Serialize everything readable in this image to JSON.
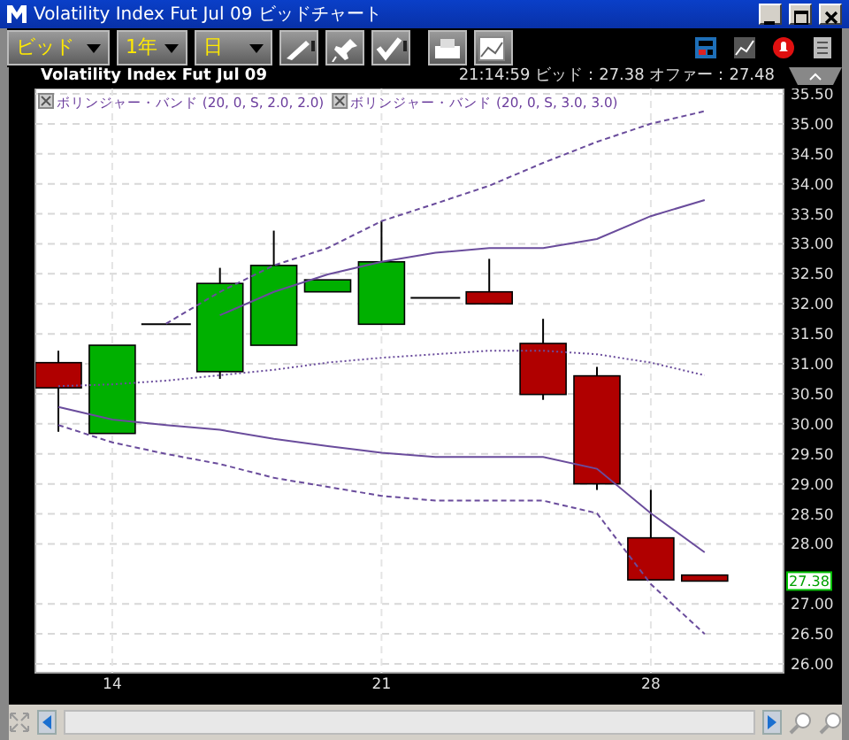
{
  "window": {
    "title": "Volatility Index Fut Jul 09 ビッドチャート"
  },
  "toolbar": {
    "dropdowns": [
      {
        "value": "ビッド"
      },
      {
        "value": "1年"
      },
      {
        "value": "日"
      }
    ]
  },
  "chart_header": {
    "instrument": "Volatility Index Fut Jul 09",
    "quote": "21:14:59 ビッド：27.38 オファー：27.48"
  },
  "legend": [
    {
      "label": "ボリンジャー・バンド (20, 0, S, 2.0, 2.0)"
    },
    {
      "label": "ボリンジャー・バンド (20, 0, S, 3.0, 3.0)"
    }
  ],
  "price_chart": {
    "chart_data": {
      "type": "line",
      "grid": true,
      "categories": [
        null,
        "14",
        null,
        null,
        null,
        null,
        "21",
        null,
        null,
        null,
        null,
        "28",
        null
      ],
      "ylim": [
        26,
        35.5
      ],
      "yticks": [
        {
          "value": 35.5,
          "label": "35.50"
        },
        {
          "value": 35,
          "label": "35.00"
        },
        {
          "value": 34.5,
          "label": "34.50"
        },
        {
          "value": 34,
          "label": "34.00"
        },
        {
          "value": 33.5,
          "label": "33.50"
        },
        {
          "value": 33,
          "label": "33.00"
        },
        {
          "value": 32.5,
          "label": "32.50"
        },
        {
          "value": 32,
          "label": "32.00"
        },
        {
          "value": 31.5,
          "label": "31.50"
        },
        {
          "value": 31,
          "label": "31.00"
        },
        {
          "value": 30.5,
          "label": "30.50"
        },
        {
          "value": 30,
          "label": "30.00"
        },
        {
          "value": 29.5,
          "label": "29.50"
        },
        {
          "value": 29,
          "label": "29.00"
        },
        {
          "value": 28.5,
          "label": "28.50"
        },
        {
          "value": 28,
          "label": "28.00"
        },
        {
          "value": 27,
          "label": "27.00"
        },
        {
          "value": 26.5,
          "label": "26.50"
        },
        {
          "value": 26,
          "label": "26.00"
        }
      ],
      "series": [
        {
          "color": "#6a4c9c",
          "line_style": "dotted",
          "values": [
            30.63,
            30.66,
            30.72,
            30.81,
            30.9,
            31.02,
            31.1,
            31.16,
            31.22,
            31.22,
            31.16,
            31.02,
            30.81
          ]
        },
        {
          "color": "#6a4c9c",
          "line_style": "solid",
          "values": [
            null,
            null,
            null,
            31.81,
            32.2,
            32.49,
            32.7,
            32.85,
            32.93,
            32.93,
            33.08,
            33.46,
            33.73
          ]
        },
        {
          "color": "#6a4c9c",
          "line_style": "solid",
          "values": [
            30.28,
            30.07,
            29.98,
            29.9,
            29.75,
            29.63,
            29.52,
            29.45,
            29.45,
            29.45,
            29.25,
            28.51,
            27.86
          ]
        },
        {
          "color": "#6a4c9c",
          "line_style": "dashed",
          "values": [
            null,
            null,
            31.67,
            32.2,
            32.64,
            32.93,
            33.38,
            33.67,
            33.97,
            34.35,
            34.7,
            35.0,
            35.21
          ]
        },
        {
          "color": "#6a4c9c",
          "line_style": "dashed",
          "values": [
            29.98,
            29.69,
            29.5,
            29.33,
            29.1,
            28.95,
            28.8,
            28.72,
            28.72,
            28.72,
            28.51,
            27.33,
            26.5
          ]
        }
      ]
    },
    "price_tag": "27.38"
  }
}
